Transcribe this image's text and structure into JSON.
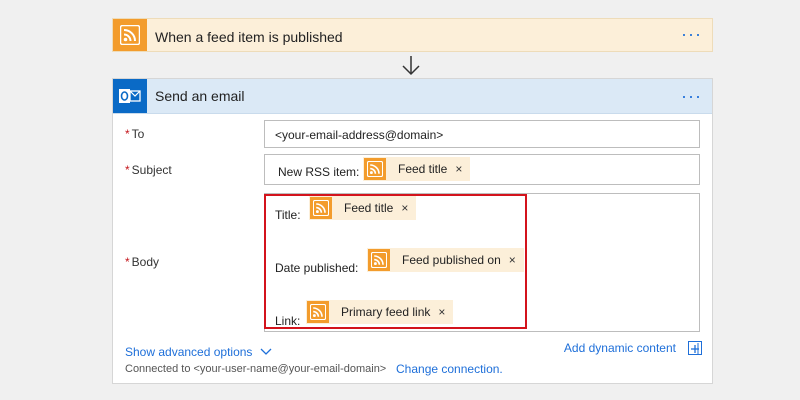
{
  "trigger": {
    "icon": "rss-icon",
    "title": "When a feed item is published",
    "more": "···"
  },
  "action": {
    "icon": "outlook-icon",
    "title": "Send an email",
    "more": "···",
    "to": {
      "label": "To",
      "value": "<your-email-address@domain>"
    },
    "subject": {
      "label": "Subject",
      "prefix": "New RSS item:",
      "token": {
        "icon": "rss-icon",
        "label": "Feed title",
        "remove": "×"
      }
    },
    "body": {
      "label": "Body",
      "lines": [
        {
          "label": "Title:",
          "token": {
            "icon": "rss-icon",
            "label": "Feed title",
            "remove": "×"
          }
        },
        {
          "label": "Date published:",
          "token": {
            "icon": "rss-icon",
            "label": "Feed published on",
            "remove": "×"
          }
        },
        {
          "label": "Link:",
          "token": {
            "icon": "rss-icon",
            "label": "Primary feed link",
            "remove": "×"
          }
        }
      ]
    },
    "required_marker": "*",
    "show_advanced": "Show advanced options",
    "add_dynamic": "Add dynamic content",
    "connected_to": "Connected to <your-user-name@your-email-domain>",
    "change_connection": "Change connection."
  },
  "colors": {
    "trigger_bg": "#fcefd9",
    "rss_orange": "#f39c2c",
    "outlook_blue": "#0a6ac6",
    "action_header_bg": "#dbe9f6",
    "link_blue": "#1e6fd9",
    "required_red": "#c4161c",
    "highlight_red": "#d3131c"
  }
}
